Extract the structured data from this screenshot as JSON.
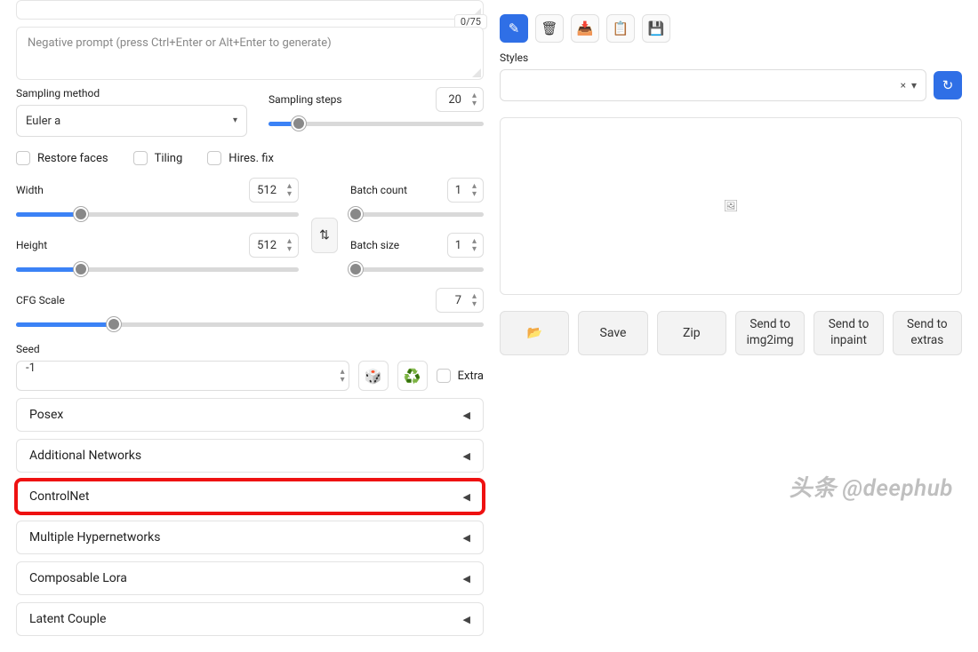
{
  "prompt": {
    "token_count": "0/75"
  },
  "negative_prompt": {
    "placeholder": "Negative prompt (press Ctrl+Enter or Alt+Enter to generate)"
  },
  "sampling": {
    "method_label": "Sampling method",
    "method_value": "Euler a",
    "steps_label": "Sampling steps",
    "steps_value": "20"
  },
  "checks": {
    "restore_faces": "Restore faces",
    "tiling": "Tiling",
    "hires_fix": "Hires. fix"
  },
  "dims": {
    "width_label": "Width",
    "width_value": "512",
    "height_label": "Height",
    "height_value": "512",
    "batch_count_label": "Batch count",
    "batch_count_value": "1",
    "batch_size_label": "Batch size",
    "batch_size_value": "1"
  },
  "cfg": {
    "label": "CFG Scale",
    "value": "7"
  },
  "seed": {
    "label": "Seed",
    "value": "-1",
    "extra_label": "Extra"
  },
  "accordions": {
    "posex": "Posex",
    "additional_networks": "Additional Networks",
    "controlnet": "ControlNet",
    "multiple_hypernetworks": "Multiple Hypernetworks",
    "composable_lora": "Composable Lora",
    "latent_couple": "Latent Couple"
  },
  "styles": {
    "label": "Styles"
  },
  "actions": {
    "save": "Save",
    "zip": "Zip",
    "send_img2img": "Send to\nimg2img",
    "send_inpaint": "Send to\ninpaint",
    "send_extras": "Send to\nextras"
  },
  "watermark": "头条 @deephub",
  "icons": {
    "folder": "📂",
    "dice": "🎲",
    "recycle": "♻️",
    "swap": "⇅",
    "refresh": "↻",
    "image_placeholder": "🖼"
  }
}
